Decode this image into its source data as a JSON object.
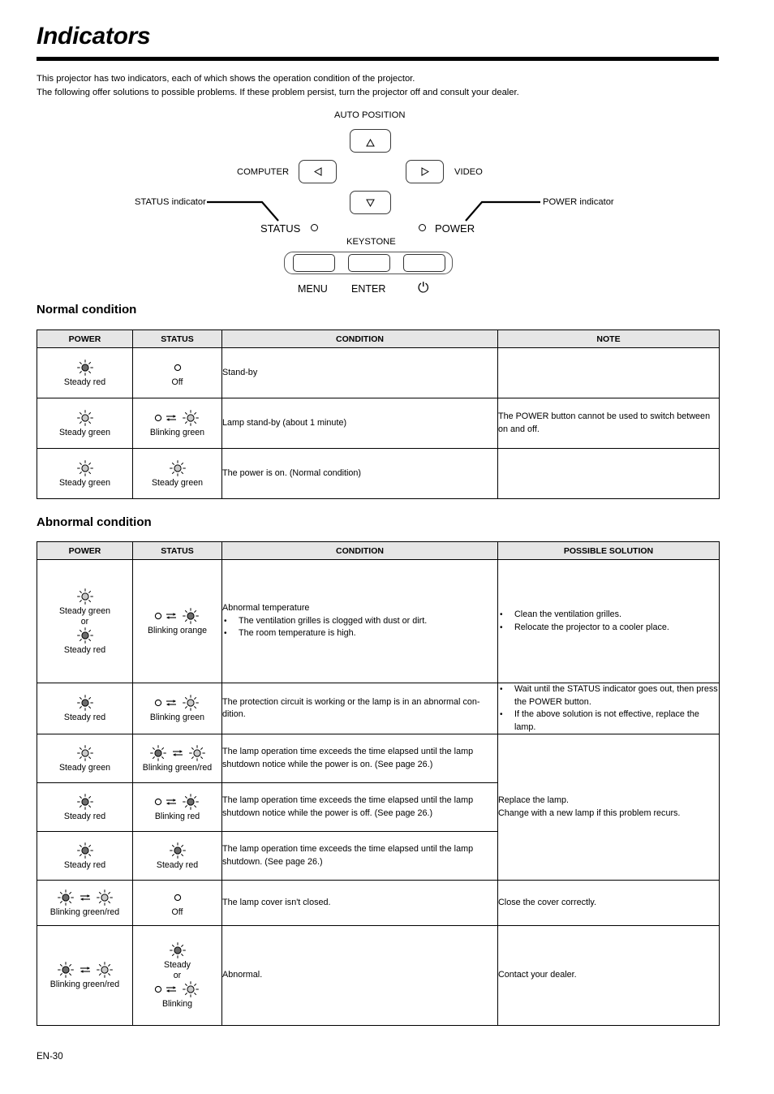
{
  "page": {
    "title": "Indicators",
    "intro_line1": "This projector has two indicators, each of which shows the operation condition of the projector.",
    "intro_line2": "The following offer solutions to possible problems. If these problem persist, turn the projector off and consult your dealer.",
    "footer": "EN-30"
  },
  "diagram": {
    "auto_position": "AUTO POSITION",
    "computer": "COMPUTER",
    "video": "VIDEO",
    "status_indicator_callout": "STATUS indicator",
    "power_indicator_callout": "POWER indicator",
    "status": "STATUS",
    "power": "POWER",
    "keystone": "KEYSTONE",
    "menu": "MENU",
    "enter": "ENTER",
    "power_symbol": "⏻"
  },
  "normal": {
    "heading": "Normal condition",
    "columns": [
      "POWER",
      "STATUS",
      "CONDITION",
      "NOTE"
    ],
    "rows": [
      {
        "power": {
          "icons": [
            {
              "type": "steady",
              "color": "red",
              "label": "Steady red"
            }
          ]
        },
        "status": {
          "icons": [
            {
              "type": "off",
              "label": "Off"
            }
          ]
        },
        "condition": "Stand-by",
        "note": ""
      },
      {
        "power": {
          "icons": [
            {
              "type": "steady",
              "color": "green",
              "label": "Steady green"
            }
          ]
        },
        "status": {
          "icons": [
            {
              "type": "blink-off",
              "color": "green",
              "label": "Blinking  green"
            }
          ]
        },
        "condition": "Lamp stand-by (about 1 minute)",
        "note": "The POWER button cannot be used to switch between on and off."
      },
      {
        "power": {
          "icons": [
            {
              "type": "steady",
              "color": "green",
              "label": "Steady green"
            }
          ]
        },
        "status": {
          "icons": [
            {
              "type": "steady",
              "color": "green",
              "label": "Steady green"
            }
          ]
        },
        "condition": "The power is on. (Normal condition)",
        "note": ""
      }
    ]
  },
  "abnormal": {
    "heading": "Abnormal condition",
    "columns": [
      "POWER",
      "STATUS",
      "CONDITION",
      "POSSIBLE SOLUTION"
    ],
    "rows": [
      {
        "power": {
          "icons": [
            {
              "type": "steady",
              "color": "green",
              "label": "Steady green"
            },
            {
              "type": "or",
              "label": "or"
            },
            {
              "type": "steady",
              "color": "red",
              "label": "Steady red"
            }
          ]
        },
        "status": {
          "icons": [
            {
              "type": "blink-off",
              "color": "orange",
              "label": "Blinking orange"
            }
          ]
        },
        "condition_head": "Abnormal temperature",
        "condition_bullets": [
          "The ventilation grilles is clogged with dust or dirt.",
          "The room temperature is high."
        ],
        "solution_bullets": [
          "Clean the ventilation grilles.",
          "Relocate the projector to a cooler place."
        ]
      },
      {
        "power": {
          "icons": [
            {
              "type": "steady",
              "color": "red",
              "label": "Steady red"
            }
          ]
        },
        "status": {
          "icons": [
            {
              "type": "blink-off",
              "color": "green",
              "label": "Blinking  green"
            }
          ]
        },
        "condition_head": "The protection circuit is working or the lamp is in an abnormal con-dition.",
        "solution_bullets": [
          "Wait until the STATUS indicator goes out, then press the POWER button.",
          "If the above solution is not effective, replace the lamp."
        ]
      },
      {
        "power": {
          "icons": [
            {
              "type": "steady",
              "color": "green",
              "label": "Steady green"
            }
          ]
        },
        "status": {
          "icons": [
            {
              "type": "blink-two",
              "label": "Blinking green/red"
            }
          ]
        },
        "condition_head": "The lamp operation time exceeds the time elapsed until the lamp shutdown notice while the power is on. (See page 26.)",
        "solution_merged": "Replace the lamp.\nChange with a new lamp if this problem recurs."
      },
      {
        "power": {
          "icons": [
            {
              "type": "steady",
              "color": "red",
              "label": "Steady red"
            }
          ]
        },
        "status": {
          "icons": [
            {
              "type": "blink-off",
              "color": "red",
              "label": "Blinking red"
            }
          ]
        },
        "condition_head": "The lamp operation time exceeds the time elapsed until the lamp shutdown notice while the power is off. (See page 26.)"
      },
      {
        "power": {
          "icons": [
            {
              "type": "steady",
              "color": "red",
              "label": "Steady red"
            }
          ]
        },
        "status": {
          "icons": [
            {
              "type": "steady",
              "color": "red",
              "label": "Steady red"
            }
          ]
        },
        "condition_head": "The lamp operation time exceeds the time elapsed until the lamp shutdown. (See page 26.)"
      },
      {
        "power": {
          "icons": [
            {
              "type": "blink-two",
              "label": "Blinking green/red"
            }
          ]
        },
        "status": {
          "icons": [
            {
              "type": "off",
              "label": "Off"
            }
          ]
        },
        "condition_head": "The lamp cover isn't closed.",
        "solution_merged": "Close the cover correctly."
      },
      {
        "power": {
          "icons": [
            {
              "type": "blink-two",
              "label": "Blinking green/red"
            }
          ]
        },
        "status": {
          "icons": [
            {
              "type": "steady",
              "color": "red",
              "label": "Steady"
            },
            {
              "type": "or",
              "label": "or"
            },
            {
              "type": "blink-off",
              "color": "green",
              "label": "Blinking"
            }
          ]
        },
        "condition_head": "Abnormal.",
        "solution_merged": "Contact your dealer."
      }
    ]
  },
  "colors": {
    "red": "#6b6b6b",
    "green": "#c9c9c9",
    "orange": "#6b6b6b",
    "header_bg": "#e6e6e6",
    "rule": "#000000"
  }
}
